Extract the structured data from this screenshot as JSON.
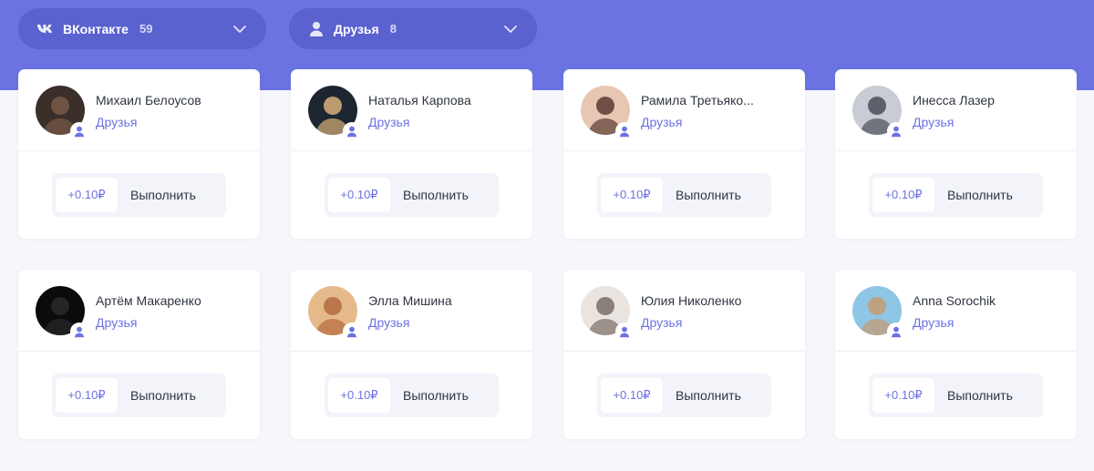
{
  "filters": [
    {
      "label": "ВКонтакте",
      "count": "59",
      "icon": "vk-icon"
    },
    {
      "label": "Друзья",
      "count": "8",
      "icon": "user-icon"
    }
  ],
  "cards": [
    {
      "name": "Михаил Белоусов",
      "type": "Друзья",
      "reward": "+0.10₽",
      "action": "Выполнить",
      "avatar_colors": [
        "#3b2f2a",
        "#7a5a48"
      ]
    },
    {
      "name": "Наталья Карпова",
      "type": "Друзья",
      "reward": "+0.10₽",
      "action": "Выполнить",
      "avatar_colors": [
        "#1d2530",
        "#d9b07a"
      ]
    },
    {
      "name": "Рамила Третьяко...",
      "type": "Друзья",
      "reward": "+0.10₽",
      "action": "Выполнить",
      "avatar_colors": [
        "#e9c6b4",
        "#5a3a30"
      ]
    },
    {
      "name": "Инесса Лазер",
      "type": "Друзья",
      "reward": "+0.10₽",
      "action": "Выполнить",
      "avatar_colors": [
        "#c9ccd4",
        "#4a4e58"
      ]
    },
    {
      "name": "Артём Макаренко",
      "type": "Друзья",
      "reward": "+0.10₽",
      "action": "Выполнить",
      "avatar_colors": [
        "#0b0b0d",
        "#2a2a2e"
      ]
    },
    {
      "name": "Элла Мишина",
      "type": "Друзья",
      "reward": "+0.10₽",
      "action": "Выполнить",
      "avatar_colors": [
        "#e6b98a",
        "#b36b3e"
      ]
    },
    {
      "name": "Юлия Николенко",
      "type": "Друзья",
      "reward": "+0.10₽",
      "action": "Выполнить",
      "avatar_colors": [
        "#e9e4e0",
        "#7a6d66"
      ]
    },
    {
      "name": "Anna Sorochik",
      "type": "Друзья",
      "reward": "+0.10₽",
      "action": "Выполнить",
      "avatar_colors": [
        "#8ec6e6",
        "#c79a6e"
      ]
    }
  ],
  "colors": {
    "accent": "#6b73e2",
    "band": "#6b73e2",
    "filter_bg": "#5a62cf",
    "text": "#2f3444"
  }
}
